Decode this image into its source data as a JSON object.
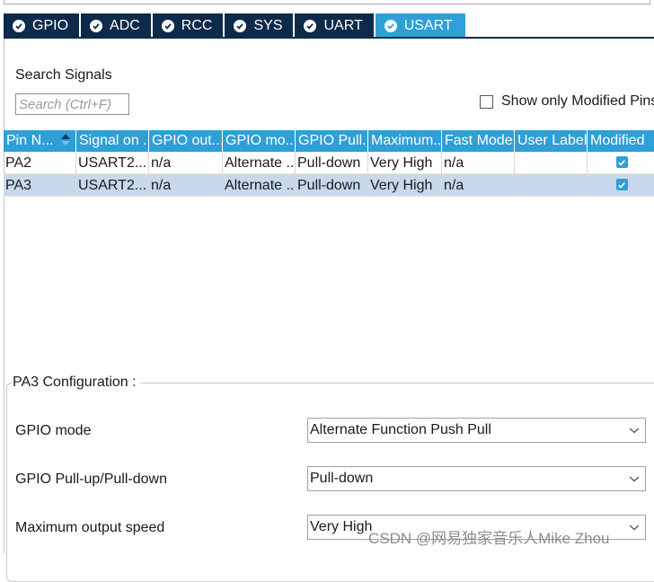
{
  "tabs": [
    {
      "label": "GPIO",
      "active": false
    },
    {
      "label": "ADC",
      "active": false
    },
    {
      "label": "RCC",
      "active": false
    },
    {
      "label": "SYS",
      "active": false
    },
    {
      "label": "UART",
      "active": false
    },
    {
      "label": "USART",
      "active": true
    }
  ],
  "search": {
    "label": "Search Signals",
    "placeholder": "Search (Ctrl+F)",
    "show_modified_label": "Show only Modified Pins",
    "show_modified_checked": false
  },
  "table": {
    "columns": [
      "Pin N...",
      "Signal on ...",
      "GPIO out...",
      "GPIO mo...",
      "GPIO Pull...",
      "Maximum...",
      "Fast Mode",
      "User Label",
      "Modified"
    ],
    "rows": [
      {
        "pin": "PA2",
        "signal": "USART2...",
        "gpio_out": "n/a",
        "gpio_mode": "Alternate ...",
        "pull": "Pull-down",
        "max_speed": "Very High",
        "fast_mode": "n/a",
        "user_label": "",
        "modified": true,
        "selected": false
      },
      {
        "pin": "PA3",
        "signal": "USART2...",
        "gpio_out": "n/a",
        "gpio_mode": "Alternate ...",
        "pull": "Pull-down",
        "max_speed": "Very High",
        "fast_mode": "n/a",
        "user_label": "",
        "modified": true,
        "selected": true
      }
    ]
  },
  "config": {
    "title": "PA3 Configuration :",
    "fields": [
      {
        "label": "GPIO mode",
        "value": "Alternate Function Push Pull"
      },
      {
        "label": "GPIO Pull-up/Pull-down",
        "value": "Pull-down"
      },
      {
        "label": "Maximum output speed",
        "value": "Very High"
      }
    ]
  },
  "watermark": "CSDN @网易独家音乐人Mike Zhou",
  "colors": {
    "tab_dark": "#0e2a4a",
    "accent_blue": "#2f9fd7",
    "selected_row": "#c8d9ec"
  }
}
